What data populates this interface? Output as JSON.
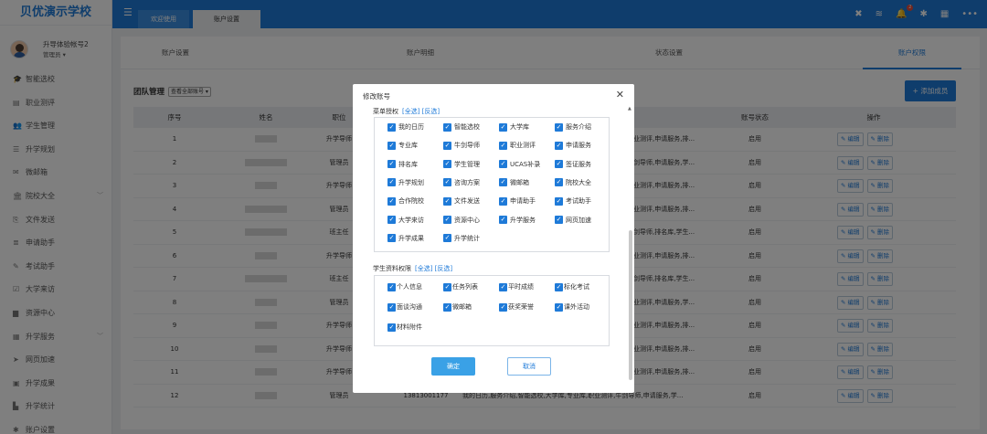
{
  "app": {
    "title": "贝优演示学校"
  },
  "user": {
    "name": "升导体验帐号2",
    "role": "管理员"
  },
  "sidebar": {
    "items": [
      {
        "label": "智能选校",
        "icon": "graduation-cap-icon",
        "glyph": "🎓",
        "chev": ""
      },
      {
        "label": "职业测评",
        "icon": "list-check-icon",
        "glyph": "▤",
        "chev": ""
      },
      {
        "label": "学生管理",
        "icon": "users-icon",
        "glyph": "👥",
        "chev": ""
      },
      {
        "label": "升学规划",
        "icon": "bars-icon",
        "glyph": "☰",
        "chev": ""
      },
      {
        "label": "微邮箱",
        "icon": "mail-icon",
        "glyph": "✉",
        "chev": ""
      },
      {
        "label": "院校大全",
        "icon": "institution-icon",
        "glyph": "🏛",
        "chev": "﹀"
      },
      {
        "label": "文件发送",
        "icon": "file-copy-icon",
        "glyph": "⎘",
        "chev": ""
      },
      {
        "label": "申请助手",
        "icon": "list-icon",
        "glyph": "≣",
        "chev": ""
      },
      {
        "label": "考试助手",
        "icon": "edit-icon",
        "glyph": "✎",
        "chev": ""
      },
      {
        "label": "大学来访",
        "icon": "calendar-check-icon",
        "glyph": "☑",
        "chev": ""
      },
      {
        "label": "资源中心",
        "icon": "folder-icon",
        "glyph": "▆",
        "chev": ""
      },
      {
        "label": "升学服务",
        "icon": "grid-icon",
        "glyph": "▦",
        "chev": "﹀"
      },
      {
        "label": "网页加速",
        "icon": "send-icon",
        "glyph": "➤",
        "chev": ""
      },
      {
        "label": "升学成果",
        "icon": "id-card-icon",
        "glyph": "▣",
        "chev": ""
      },
      {
        "label": "升学统计",
        "icon": "bar-chart-icon",
        "glyph": "▙",
        "chev": ""
      },
      {
        "label": "账户设置",
        "icon": "gear-icon",
        "glyph": "✱",
        "chev": ""
      }
    ]
  },
  "topbar": {
    "tabs": [
      {
        "label": "欢迎使用"
      },
      {
        "label": "账户设置"
      }
    ],
    "notification_count": "2"
  },
  "subtabs": [
    {
      "label": "账户设置"
    },
    {
      "label": "账户明细"
    },
    {
      "label": "状态设置"
    },
    {
      "label": "账户权限"
    }
  ],
  "team": {
    "label": "团队管理",
    "select_value": "查看全部账号 ▾"
  },
  "add_member_label": "+ 添加成员",
  "table": {
    "headers": [
      "序号",
      "姓名",
      "职位",
      "账号状态",
      "操作"
    ],
    "edit_label": "✎ 编辑",
    "delete_label": "✎ 删除",
    "rows": [
      {
        "no": "1",
        "pos": "升学导师",
        "perm": "职业测评,申请服务,排...",
        "status": "启用"
      },
      {
        "no": "2",
        "pos": "管理员",
        "perm": "牛剑导师,申请服务,学...",
        "status": "启用"
      },
      {
        "no": "3",
        "pos": "升学导师",
        "perm": "职业测评,申请服务,排...",
        "status": "启用"
      },
      {
        "no": "4",
        "pos": "管理员",
        "perm": "职业测评,申请服务,排...",
        "status": "启用"
      },
      {
        "no": "5",
        "pos": "班主任",
        "perm": "牛剑导师,排名库,学生...",
        "status": "启用"
      },
      {
        "no": "6",
        "pos": "升学导师",
        "perm": "职业测评,申请服务,排...",
        "status": "启用"
      },
      {
        "no": "7",
        "pos": "班主任",
        "perm": "牛剑导师,排名库,学生...",
        "status": "启用"
      },
      {
        "no": "8",
        "pos": "管理员",
        "perm": "职业测评,申请服务,学...",
        "status": "启用"
      },
      {
        "no": "9",
        "pos": "升学导师",
        "perm": "职业测评,申请服务,排...",
        "status": "启用"
      },
      {
        "no": "10",
        "pos": "升学导师",
        "perm": "职业测评,申请服务,排...",
        "status": "启用"
      },
      {
        "no": "11",
        "pos": "升学导师",
        "perm": "职业测评,申请服务,排...",
        "status": "启用"
      },
      {
        "no": "12",
        "pos": "管理员",
        "phone": "13813001177",
        "perm": "我的日历,服务介绍,智能选校,大学库,专业库,职业测评,牛剑导师,申请服务,学...",
        "status": "启用"
      }
    ]
  },
  "modal": {
    "title": "修改账号",
    "menu_section": {
      "label": "菜单授权",
      "links": "[全选] [反选]"
    },
    "menu_items": [
      "我的日历",
      "智能选校",
      "大学库",
      "服务介绍",
      "专业库",
      "牛剑导师",
      "职业测评",
      "申请服务",
      "排名库",
      "学生管理",
      "UCAS补录",
      "签证服务",
      "升学规划",
      "咨询方案",
      "微邮箱",
      "院校大全",
      "合作院校",
      "文件发送",
      "申请助手",
      "考试助手",
      "大学来访",
      "资源中心",
      "升学服务",
      "网页加速",
      "升学成果",
      "升学统计"
    ],
    "student_section": {
      "label": "学生资料权限",
      "links": "[全选] [反选]"
    },
    "student_items": [
      "个人信息",
      "任务列表",
      "平时成绩",
      "标化考试",
      "面谈沟通",
      "微邮箱",
      "获奖荣誉",
      "课外活动",
      "材料附件"
    ],
    "ok_label": "确定",
    "cancel_label": "取消"
  }
}
